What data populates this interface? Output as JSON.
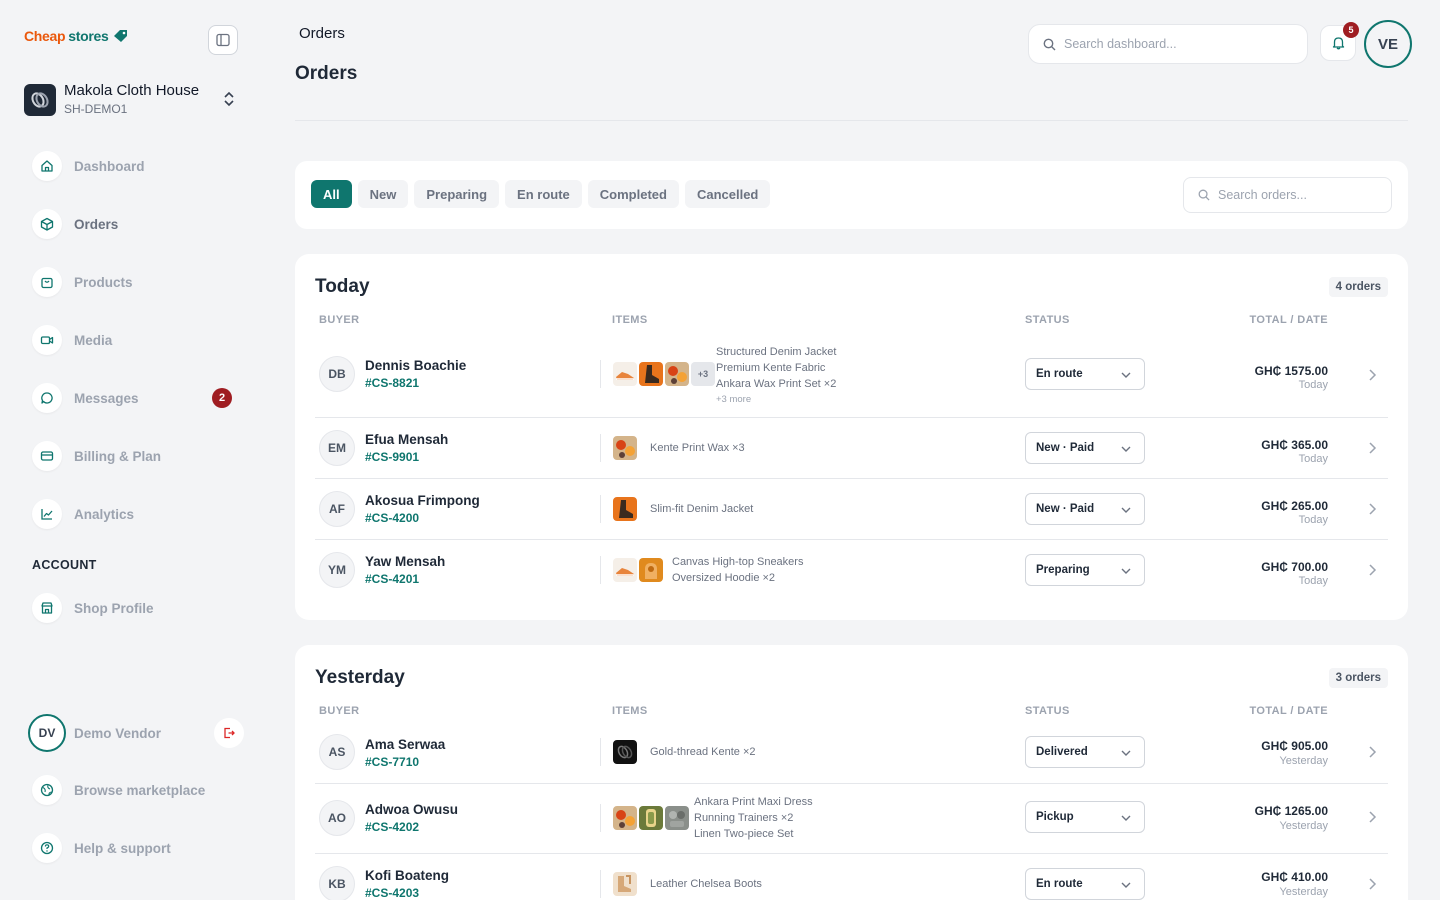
{
  "brand": {
    "part1": "Cheap",
    "part2": "stores"
  },
  "shop": {
    "name": "Makola Cloth House",
    "id": "SH-DEMO1"
  },
  "nav": [
    {
      "label": "Dashboard",
      "icon": "home-icon"
    },
    {
      "label": "Orders",
      "icon": "box-icon"
    },
    {
      "label": "Products",
      "icon": "bag-icon"
    },
    {
      "label": "Media",
      "icon": "video-icon"
    },
    {
      "label": "Messages",
      "icon": "chat-icon",
      "badge": "2"
    },
    {
      "label": "Billing & Plan",
      "icon": "card-icon"
    },
    {
      "label": "Analytics",
      "icon": "chart-icon"
    }
  ],
  "account": {
    "label": "ACCOUNT",
    "items": [
      {
        "label": "Shop Profile",
        "icon": "store-icon"
      }
    ]
  },
  "vendor": {
    "initials": "DV",
    "name": "Demo Vendor"
  },
  "footer_links": [
    {
      "label": "Browse marketplace",
      "icon": "globe-icon"
    },
    {
      "label": "Help & support",
      "icon": "help-icon"
    }
  ],
  "header": {
    "breadcrumb": "Orders",
    "title": "Orders",
    "search_placeholder": "Search dashboard...",
    "notifications": "5",
    "user_initials": "VE"
  },
  "filters": {
    "tabs": [
      "All",
      "New",
      "Preparing",
      "En route",
      "Completed",
      "Cancelled"
    ],
    "active": "All",
    "search_placeholder": "Search orders..."
  },
  "columns": {
    "buyer": "BUYER",
    "items": "ITEMS",
    "status": "STATUS",
    "total": "TOTAL / DATE"
  },
  "colors": {
    "accent": "#0f766e",
    "brand_orange": "#ea580c",
    "badge_red": "#9f1d22"
  },
  "groups": [
    {
      "title": "Today",
      "count": "4 orders",
      "orders": [
        {
          "initials": "DB",
          "buyer": "Dennis Boachie",
          "id": "#CS-8821",
          "thumbs": [
            "sneaker",
            "boot",
            "fabric"
          ],
          "thumbs_more": "+3",
          "items": [
            "Structured Denim Jacket",
            "Premium Kente Fabric",
            "Ankara Wax Print Set ×2"
          ],
          "items_more": "+3 more",
          "status": "En route",
          "total": "GH₵ 1575.00",
          "date": "Today"
        },
        {
          "initials": "EM",
          "buyer": "Efua Mensah",
          "id": "#CS-9901",
          "thumbs": [
            "fabric"
          ],
          "items": [
            "Kente Print Wax ×3"
          ],
          "status": "New · Paid",
          "total": "GH₵ 365.00",
          "date": "Today"
        },
        {
          "initials": "AF",
          "buyer": "Akosua Frimpong",
          "id": "#CS-4200",
          "thumbs": [
            "boot"
          ],
          "items": [
            "Slim-fit Denim Jacket"
          ],
          "status": "New · Paid",
          "total": "GH₵ 265.00",
          "date": "Today"
        },
        {
          "initials": "YM",
          "buyer": "Yaw Mensah",
          "id": "#CS-4201",
          "thumbs": [
            "sneaker",
            "hoodie"
          ],
          "items": [
            "Canvas High-top Sneakers",
            "Oversized Hoodie ×2"
          ],
          "status": "Preparing",
          "total": "GH₵ 700.00",
          "date": "Today"
        }
      ]
    },
    {
      "title": "Yesterday",
      "count": "3 orders",
      "orders": [
        {
          "initials": "AS",
          "buyer": "Ama Serwaa",
          "id": "#CS-7710",
          "thumbs": [
            "black"
          ],
          "items": [
            "Gold-thread Kente ×2"
          ],
          "status": "Delivered",
          "total": "GH₵ 905.00",
          "date": "Yesterday"
        },
        {
          "initials": "AO",
          "buyer": "Adwoa Owusu",
          "id": "#CS-4202",
          "thumbs": [
            "fabric",
            "green",
            "grey"
          ],
          "items": [
            "Ankara Print Maxi Dress",
            "Running Trainers ×2",
            "Linen Two-piece Set"
          ],
          "status": "Pickup",
          "total": "GH₵ 1265.00",
          "date": "Yesterday"
        },
        {
          "initials": "KB",
          "buyer": "Kofi Boateng",
          "id": "#CS-4203",
          "thumbs": [
            "tan"
          ],
          "items": [
            "Leather Chelsea Boots"
          ],
          "status": "En route",
          "total": "GH₵ 410.00",
          "date": "Yesterday"
        }
      ]
    }
  ]
}
